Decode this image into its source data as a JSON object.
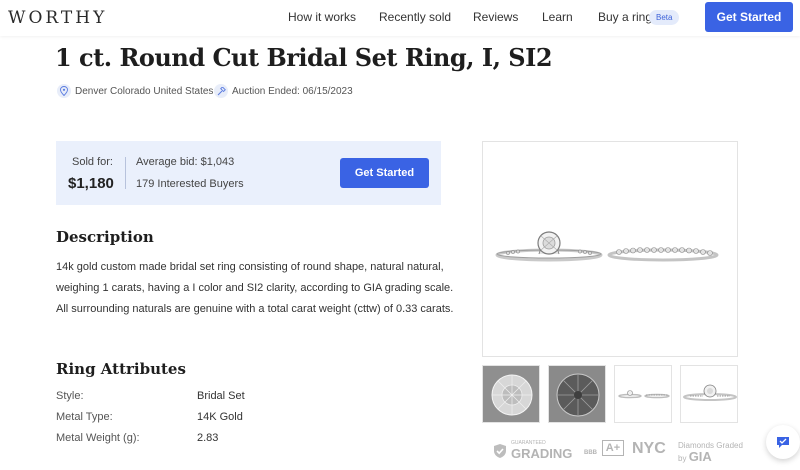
{
  "header": {
    "logo": "WORTHY",
    "nav": [
      "How it works",
      "Recently sold",
      "Reviews",
      "Learn",
      "Buy a ring"
    ],
    "beta": "Beta",
    "cta": "Get Started"
  },
  "listing": {
    "title": "1 ct. Round Cut Bridal Set Ring, I, SI2",
    "location": "Denver Colorado United States",
    "auction_ended": "Auction Ended: 06/15/2023"
  },
  "sold_box": {
    "sold_label": "Sold for:",
    "sold_price": "$1,180",
    "average_bid": "Average bid: $1,043",
    "interested": "179 Interested Buyers",
    "cta": "Get Started"
  },
  "description": {
    "heading": "Description",
    "text": "14k gold custom made bridal set ring consisting of round shape, natural natural, weighing 1 carats, having a I color and SI2 clarity, according to GIA grading scale. All surrounding naturals are genuine with a total carat weight (cttw) of 0.33 carats."
  },
  "attributes": {
    "heading": "Ring Attributes",
    "rows": [
      {
        "key": "Style:",
        "value": "Bridal Set"
      },
      {
        "key": "Metal Type:",
        "value": "14K Gold"
      },
      {
        "key": "Metal Weight (g):",
        "value": "2.83"
      }
    ]
  },
  "badges": {
    "grading_top": "GUARANTEED",
    "grading": "GRADING",
    "bbb": "A+",
    "bbb_small": "BBB",
    "nyc": "NYC",
    "gia_top": "Diamonds Graded",
    "gia": "GIA",
    "gia_by": "by"
  },
  "colors": {
    "accent": "#3a63e4",
    "sold_box_bg": "#eaf0fc"
  }
}
